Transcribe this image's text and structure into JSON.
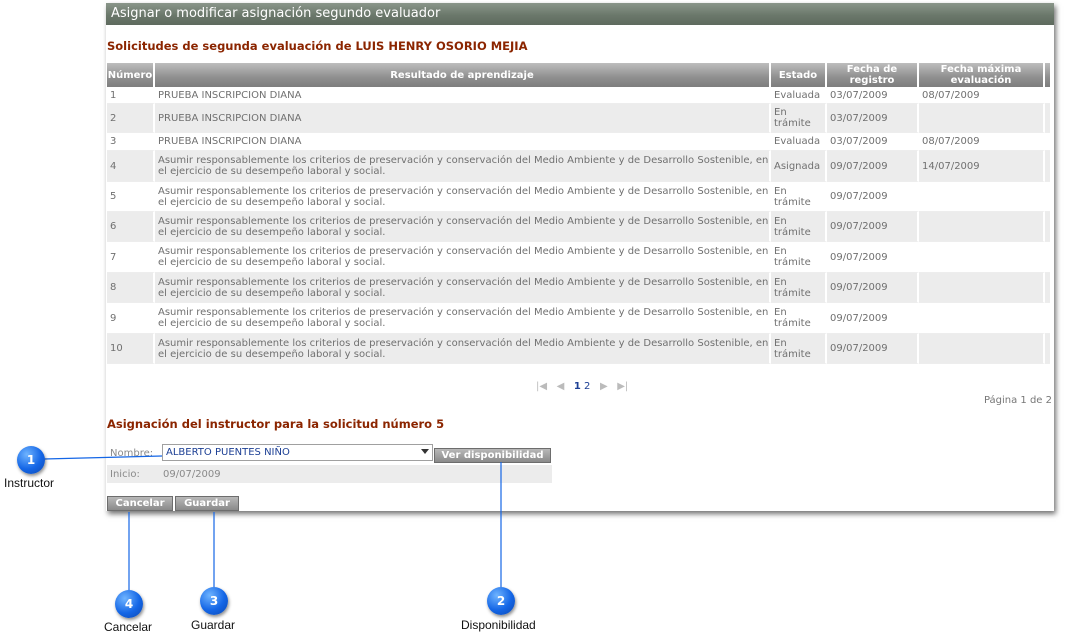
{
  "window_title": "Asignar o modificar asignación segundo evaluador",
  "requests_heading": "Solicitudes de segunda evaluación de LUIS HENRY OSORIO MEJIA",
  "table": {
    "headers": [
      "Número",
      "Resultado de aprendizaje",
      "Estado",
      "Fecha de registro",
      "Fecha máxima evaluación"
    ],
    "rows": [
      {
        "num": "1",
        "result": "PRUEBA INSCRIPCION DIANA",
        "state": "Evaluada",
        "registered": "03/07/2009",
        "max_date": "08/07/2009"
      },
      {
        "num": "2",
        "result": "PRUEBA INSCRIPCION DIANA",
        "state": "En trámite",
        "registered": "03/07/2009",
        "max_date": ""
      },
      {
        "num": "3",
        "result": "PRUEBA INSCRIPCION DIANA",
        "state": "Evaluada",
        "registered": "03/07/2009",
        "max_date": "08/07/2009"
      },
      {
        "num": "4",
        "result": "Asumir responsablemente los criterios de preservación y conservación del Medio Ambiente y de Desarrollo Sostenible, en el ejercicio de su desempeño laboral y social.",
        "state": "Asignada",
        "registered": "09/07/2009",
        "max_date": "14/07/2009"
      },
      {
        "num": "5",
        "result": "Asumir responsablemente los criterios de preservación y conservación del Medio Ambiente y de Desarrollo Sostenible, en el ejercicio de su desempeño laboral y social.",
        "state": "En trámite",
        "registered": "09/07/2009",
        "max_date": ""
      },
      {
        "num": "6",
        "result": "Asumir responsablemente los criterios de preservación y conservación del Medio Ambiente y de Desarrollo Sostenible, en el ejercicio de su desempeño laboral y social.",
        "state": "En trámite",
        "registered": "09/07/2009",
        "max_date": ""
      },
      {
        "num": "7",
        "result": "Asumir responsablemente los criterios de preservación y conservación del Medio Ambiente y de Desarrollo Sostenible, en el ejercicio de su desempeño laboral y social.",
        "state": "En trámite",
        "registered": "09/07/2009",
        "max_date": ""
      },
      {
        "num": "8",
        "result": "Asumir responsablemente los criterios de preservación y conservación del Medio Ambiente y de Desarrollo Sostenible, en el ejercicio de su desempeño laboral y social.",
        "state": "En trámite",
        "registered": "09/07/2009",
        "max_date": ""
      },
      {
        "num": "9",
        "result": "Asumir responsablemente los criterios de preservación y conservación del Medio Ambiente y de Desarrollo Sostenible, en el ejercicio de su desempeño laboral y social.",
        "state": "En trámite",
        "registered": "09/07/2009",
        "max_date": ""
      },
      {
        "num": "10",
        "result": "Asumir responsablemente los criterios de preservación y conservación del Medio Ambiente y de Desarrollo Sostenible, en el ejercicio de su desempeño laboral y social.",
        "state": "En trámite",
        "registered": "09/07/2009",
        "max_date": ""
      }
    ]
  },
  "pager": {
    "first": "|◀",
    "prev": "◀",
    "current_page": "1",
    "next_page": "2",
    "next": "▶",
    "last": "▶|",
    "info": "Página 1 de 2"
  },
  "assignment": {
    "heading": "Asignación del instructor para la solicitud número 5",
    "name_label": "Nombre:",
    "name_value": "ALBERTO PUENTES NIÑO",
    "availability_button": "Ver disponibilidad",
    "start_label": "Inicio:",
    "start_value": "09/07/2009",
    "cancel_button": "Cancelar",
    "save_button": "Guardar"
  },
  "callouts": [
    {
      "number": "1",
      "label": "Instructor"
    },
    {
      "number": "2",
      "label": "Disponibilidad"
    },
    {
      "number": "3",
      "label": "Guardar"
    },
    {
      "number": "4",
      "label": "Cancelar"
    }
  ]
}
